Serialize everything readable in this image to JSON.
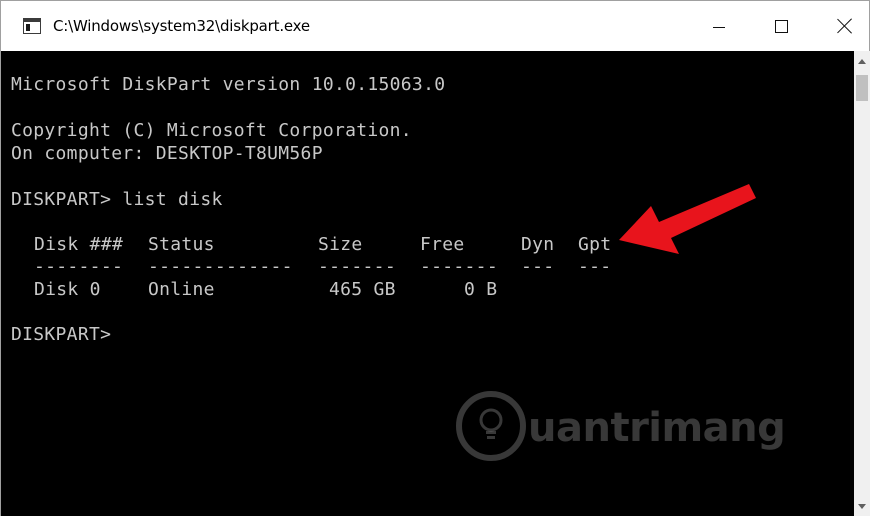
{
  "window": {
    "title": "C:\\Windows\\system32\\diskpart.exe",
    "icon": "console-window-icon",
    "controls": {
      "minimize_icon": "minimize-icon",
      "maximize_icon": "maximize-icon",
      "close_icon": "close-icon"
    }
  },
  "console": {
    "text_color": "#c8c8c8",
    "background": "#000000",
    "version_line": "Microsoft DiskPart version 10.0.15063.0",
    "copyright_line": "Copyright (C) Microsoft Corporation.",
    "computer_line": "On computer: DESKTOP-T8UM56P",
    "command_line": "DISKPART> list disk",
    "table": {
      "headers": [
        "Disk ###",
        "Status",
        "Size",
        "Free",
        "Dyn",
        "Gpt"
      ],
      "separators": [
        "--------",
        "-------------",
        "-------",
        "-------",
        "---",
        "---"
      ],
      "rows": [
        [
          "Disk 0",
          "Online",
          "465 GB",
          "0 B",
          "",
          ""
        ]
      ]
    },
    "prompt_line": "DISKPART>"
  },
  "annotation": {
    "arrow_color": "#e8141c",
    "arrow_target": "Gpt"
  },
  "watermark": {
    "text": "uantrimang",
    "logo": "lightbulb-logo-icon"
  }
}
